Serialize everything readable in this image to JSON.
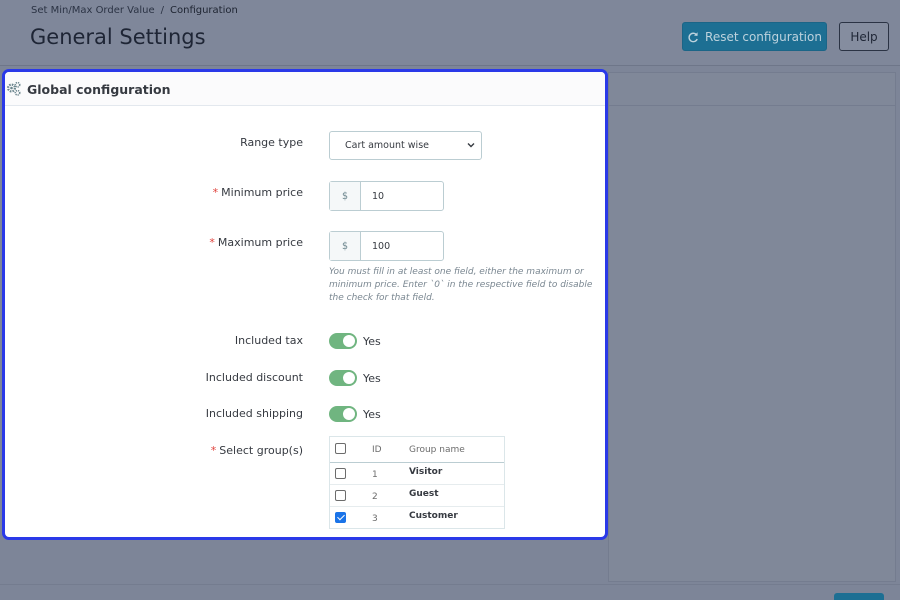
{
  "breadcrumb": {
    "parent": "Set Min/Max Order Value",
    "separator": "/",
    "current": "Configuration"
  },
  "header": {
    "title": "General Settings",
    "reset_label": "Reset configuration",
    "help_label": "Help"
  },
  "card": {
    "title": "Global configuration"
  },
  "form": {
    "range_type": {
      "label": "Range type",
      "value": "Cart amount wise"
    },
    "minimum_price": {
      "required": "*",
      "label": "Minimum price",
      "currency": "$",
      "value": "10"
    },
    "maximum_price": {
      "required": "*",
      "label": "Maximum price",
      "currency": "$",
      "value": "100"
    },
    "help_text": "You must fill in at least one field, either the maximum or minimum price. Enter `0` in the respective field to disable the check for that field.",
    "included_tax": {
      "label": "Included tax",
      "state": "Yes"
    },
    "included_discount": {
      "label": "Included discount",
      "state": "Yes"
    },
    "included_shipping": {
      "label": "Included shipping",
      "state": "Yes"
    },
    "groups": {
      "required": "*",
      "label": "Select group(s)",
      "columns": [
        "ID",
        "Group name"
      ],
      "rows": [
        {
          "id": "1",
          "name": "Visitor",
          "checked": false
        },
        {
          "id": "2",
          "name": "Guest",
          "checked": false
        },
        {
          "id": "3",
          "name": "Customer",
          "checked": true
        }
      ]
    }
  },
  "colors": {
    "accent": "#2a39e8",
    "toggle_on": "#70b580",
    "primary_button": "#1d6f93",
    "required": "#e0413b"
  }
}
